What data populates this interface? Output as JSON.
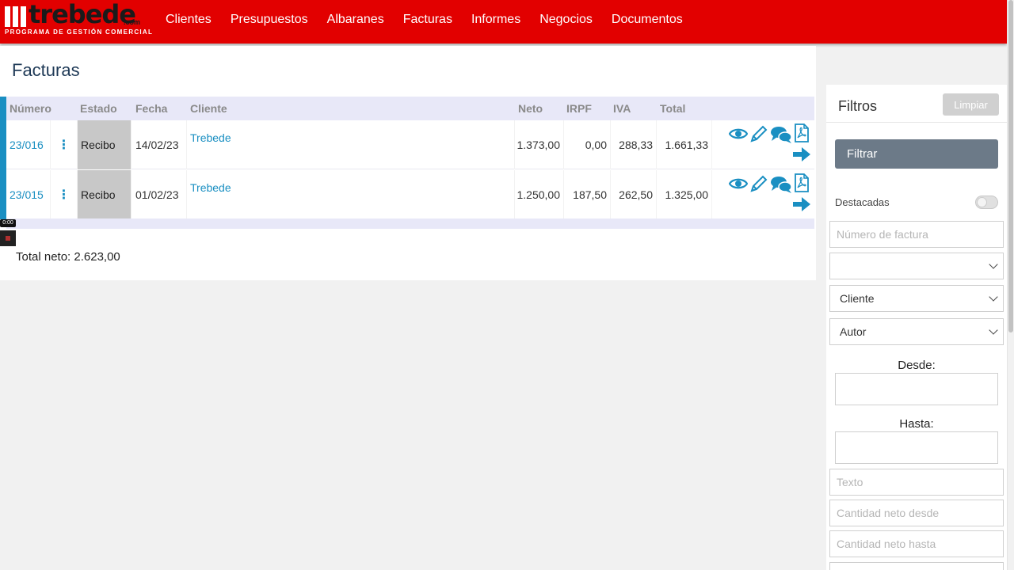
{
  "brand": {
    "name": "trebede",
    "suffix": ".com",
    "tagline": "PROGRAMA DE GESTIÓN COMERCIAL",
    "color": "#e20000"
  },
  "nav": [
    "Clientes",
    "Presupuestos",
    "Albaranes",
    "Facturas",
    "Informes",
    "Negocios",
    "Documentos"
  ],
  "page": {
    "title": "Facturas"
  },
  "table": {
    "columns": [
      "Número",
      "Estado",
      "Fecha",
      "Cliente",
      "Neto",
      "IRPF",
      "IVA",
      "Total"
    ],
    "rows": [
      {
        "numero": "23/016",
        "estado": "Recibo",
        "fecha": "14/02/23",
        "cliente": "Trebede",
        "neto": "1.373,00",
        "irpf": "0,00",
        "iva": "288,33",
        "total": "1.661,33"
      },
      {
        "numero": "23/015",
        "estado": "Recibo",
        "fecha": "01/02/23",
        "cliente": "Trebede",
        "neto": "1.250,00",
        "irpf": "187,50",
        "iva": "262,50",
        "total": "1.325,00"
      }
    ],
    "row_actions": [
      "eye-icon",
      "pencil-icon",
      "comments-icon",
      "pdf-icon",
      "arrow-right-icon"
    ]
  },
  "recording": {
    "timer": "0:00"
  },
  "summary": {
    "total_neto": "Total neto: 2.623,00"
  },
  "filters": {
    "title": "Filtros",
    "clear_label": "Limpiar",
    "apply_label": "Filtrar",
    "featured_label": "Destacadas",
    "featured_on": false,
    "invoice_number_placeholder": "Número de factura",
    "status_select": "",
    "client_select": "Cliente",
    "author_select": "Autor",
    "from_label": "Desde:",
    "to_label": "Hasta:",
    "text_placeholder": "Texto",
    "net_from_placeholder": "Cantidad neto desde",
    "net_to_placeholder": "Cantidad neto hasta"
  },
  "colors": {
    "accent": "#1a8fc2",
    "header_bg": "#e8e8f8",
    "filter_button": "#6c7a88"
  }
}
